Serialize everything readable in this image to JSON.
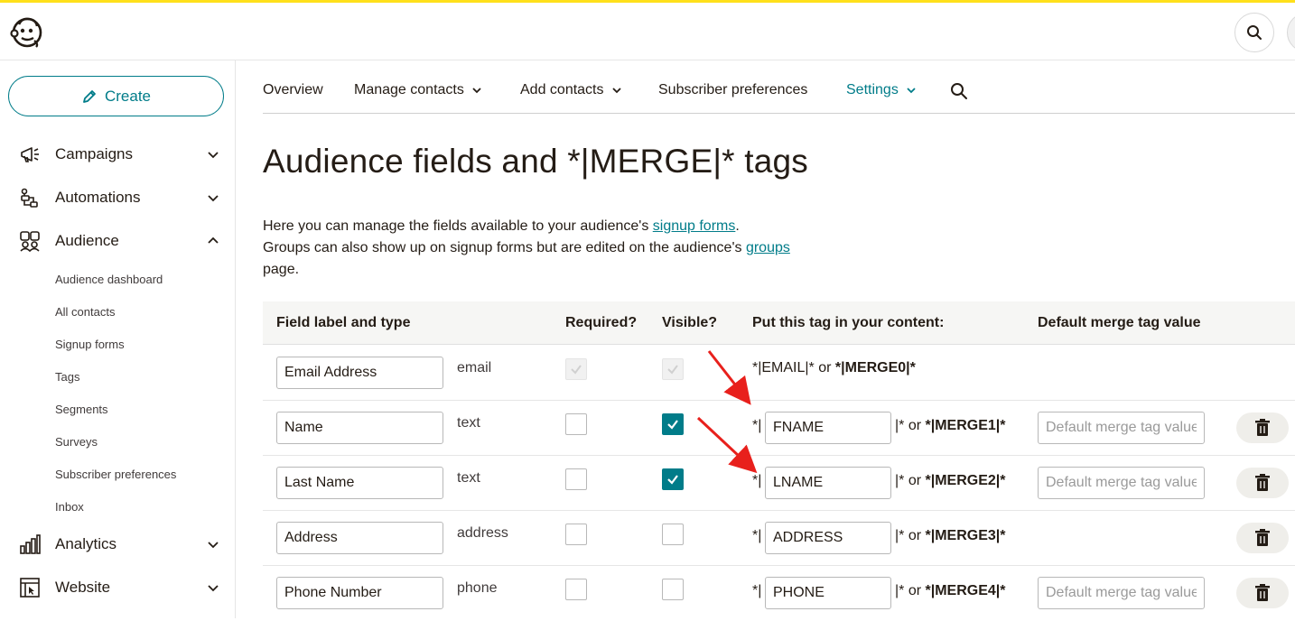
{
  "header": {
    "logo_icon": "mailchimp-freddie-icon",
    "search_icon": "search-icon"
  },
  "sidebar": {
    "create_label": "Create",
    "nav": [
      {
        "label": "Campaigns",
        "icon": "megaphone-icon",
        "expanded": false
      },
      {
        "label": "Automations",
        "icon": "automation-flow-icon",
        "expanded": false
      },
      {
        "label": "Audience",
        "icon": "audience-icon",
        "expanded": true
      },
      {
        "label": "Analytics",
        "icon": "bar-chart-icon",
        "expanded": false
      },
      {
        "label": "Website",
        "icon": "website-icon",
        "expanded": false
      }
    ],
    "audience_sub": [
      "Audience dashboard",
      "All contacts",
      "Signup forms",
      "Tags",
      "Segments",
      "Surveys",
      "Subscriber preferences",
      "Inbox"
    ]
  },
  "tabs": [
    {
      "label": "Overview",
      "has_menu": false
    },
    {
      "label": "Manage contacts",
      "has_menu": true
    },
    {
      "label": "Add contacts",
      "has_menu": true
    },
    {
      "label": "Subscriber preferences",
      "has_menu": false
    },
    {
      "label": "Settings",
      "has_menu": true,
      "active": true
    }
  ],
  "page": {
    "title": "Audience fields and *|MERGE|* tags",
    "intro_line1_pre": "Here you can manage the fields available to your audience's ",
    "intro_link1": "signup forms",
    "intro_line1_post": ".",
    "intro_line2_pre": "Groups can also show up on signup forms but are edited on the audience's ",
    "intro_link2": "groups",
    "intro_line3": "page."
  },
  "table": {
    "headers": {
      "label": "Field label and type",
      "required": "Required?",
      "visible": "Visible?",
      "tag": "Put this tag in your content:",
      "default": "Default merge tag value"
    },
    "default_placeholder": "Default merge tag value",
    "tag_prefix": "*|",
    "tag_suffix": "|* or ",
    "email_row": {
      "label": "Email Address",
      "type": "email",
      "tag_text": "*|EMAIL|* or ",
      "merge": "*|MERGE0|*"
    },
    "rows": [
      {
        "label": "Name",
        "type": "text",
        "required": false,
        "visible": true,
        "tag": "FNAME",
        "merge": "*|MERGE1|*",
        "has_default": true
      },
      {
        "label": "Last Name",
        "type": "text",
        "required": false,
        "visible": true,
        "tag": "LNAME",
        "merge": "*|MERGE2|*",
        "has_default": true
      },
      {
        "label": "Address",
        "type": "address",
        "required": false,
        "visible": false,
        "tag": "ADDRESS",
        "merge": "*|MERGE3|*",
        "has_default": false
      },
      {
        "label": "Phone Number",
        "type": "phone",
        "required": false,
        "visible": false,
        "tag": "PHONE",
        "merge": "*|MERGE4|*",
        "has_default": true
      }
    ]
  },
  "colors": {
    "accent": "#007c89",
    "brand_yellow": "#ffe01b",
    "annotation_red": "#e8201c"
  }
}
